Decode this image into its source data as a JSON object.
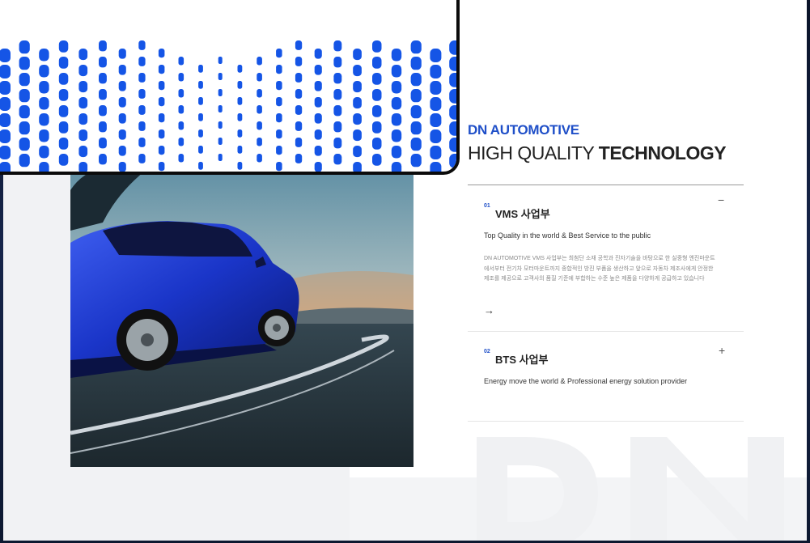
{
  "brand": "DN AUTOMOTIVE",
  "headline": {
    "prefix": "HIGH QUALITY ",
    "bold": "TECHNOLOGY"
  },
  "accordion": [
    {
      "number": "01",
      "title": "VMS 사업부",
      "subtitle": "Top Quality in the world & Best Service to the public",
      "body": "DN AUTOMOTIVE VMS 사업부는 최첨단 소재 공학과 진자기술을 바탕으로 한 실중형 엔진마운트에서부터 전기차 모터마운트까지 종합적인 방진 부품을 생산하고 앞으로 자동차 제조사에게 안정한 제조를 제공으로 고객사의 품질 기준에 부합하는 수준 높은 제품을 다양하게 공급하고 있습니다",
      "toggle": "−",
      "arrow": "→",
      "expanded": true
    },
    {
      "number": "02",
      "title": "BTS 사업부",
      "subtitle": "Energy move the world & Professional energy solution provider",
      "toggle": "+",
      "expanded": false
    }
  ],
  "cursor": "↓",
  "colors": {
    "accent": "#1f4fc8",
    "pattern": "#1555e6",
    "car": "#1a35c8"
  },
  "icons": [
    "arrow-right-icon",
    "minus-icon",
    "plus-icon",
    "down-arrow-cursor-icon"
  ]
}
